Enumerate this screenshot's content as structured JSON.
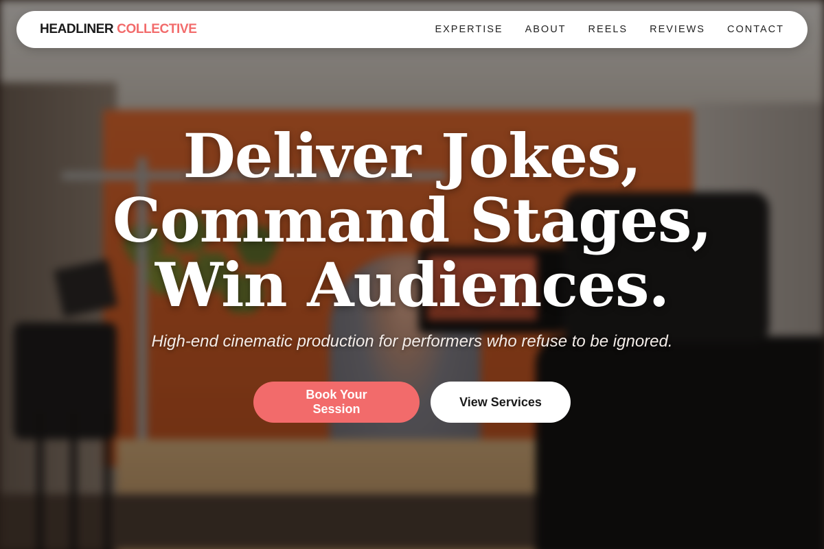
{
  "nav": {
    "brand_main": "HEADLINER",
    "brand_accent": "COLLECTIVE",
    "links": [
      "EXPERTISE",
      "ABOUT",
      "REELS",
      "REVIEWS",
      "CONTACT"
    ]
  },
  "hero": {
    "headline": [
      "Deliver Jokes,",
      "Command Stages,",
      "Win Audiences."
    ],
    "subheadline": "High-end cinematic production for performers who refuse to be ignored.",
    "primary_cta": "Book Your Session",
    "secondary_cta": "View Services"
  },
  "colors": {
    "accent": "#f26b6b",
    "nav_bg": "#ffffff",
    "headline": "#ffffff"
  },
  "icons": []
}
